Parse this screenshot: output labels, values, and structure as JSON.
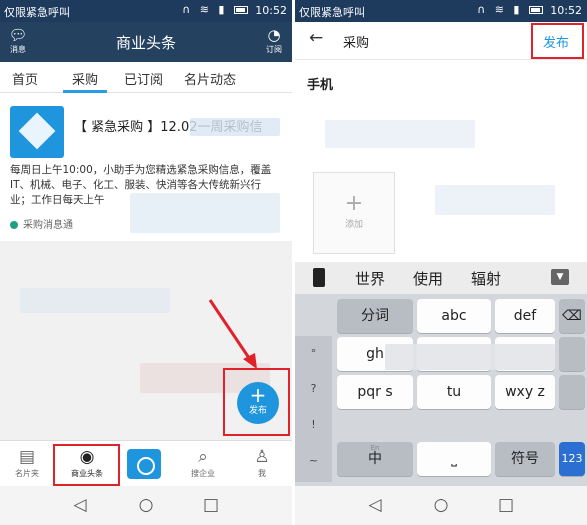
{
  "colors": {
    "status_bar": "#1e3a5c",
    "header": "#24425f",
    "accent": "#1f95dd",
    "highlight": "#e0222a"
  },
  "status_bar": {
    "carrier": "仅限紧急呼叫",
    "icons": "☺ ◎ ▣",
    "right_icons": "∩ ≋ ▮",
    "time": "10:52"
  },
  "left": {
    "header": {
      "title": "商业头条",
      "left_label": "消息",
      "right_label": "订阅"
    },
    "tabs": [
      "首页",
      "采购",
      "已订阅",
      "名片动态"
    ],
    "card": {
      "title": "【 紧急采购 】12.02一周采购信",
      "desc": "每周日上午10:00，小助手为您精选紧急采购信息，覆盖IT、机械、电子、化工、服装、快消等各大传统新兴行业；工作日每天上午",
      "source": "采购消息通"
    },
    "fab": {
      "icon": "+",
      "label": "发布"
    },
    "bottom_nav": [
      {
        "label": "名片夹",
        "icon": "card-icon"
      },
      {
        "label": "商业头条",
        "icon": "record-icon"
      },
      {
        "label": "",
        "icon": "camera-icon"
      },
      {
        "label": "搜企业",
        "icon": "search-icon"
      },
      {
        "label": "我",
        "icon": "person-icon"
      }
    ]
  },
  "right": {
    "header": {
      "back": "←",
      "title": "采购",
      "publish": "发布"
    },
    "body_text": "手机",
    "add_photo": {
      "icon": "+",
      "label": "添加"
    },
    "candidates": [
      "世界",
      "使用",
      "辐射"
    ],
    "collapse_icon": "▼",
    "side_keys": [
      "°",
      "?",
      "!",
      "~"
    ],
    "keys": {
      "row1": [
        {
          "sub": "",
          "main": "分词"
        },
        {
          "sub": "",
          "main": "abc"
        },
        {
          "sub": "",
          "main": "def"
        },
        {
          "sub": "",
          "main": "⌫"
        }
      ],
      "row2": [
        {
          "sub": "",
          "main": "gh"
        },
        {
          "sub": "",
          "main": ""
        },
        {
          "sub": "",
          "main": ""
        },
        {
          "sub": "",
          "main": ""
        }
      ],
      "row3": [
        {
          "sub": "",
          "main": "pqr s"
        },
        {
          "sub": "",
          "main": "tu"
        },
        {
          "sub": "",
          "main": "wxy z"
        },
        {
          "sub": "",
          "main": ""
        }
      ],
      "row4": [
        {
          "sub": "En",
          "main": "中"
        },
        {
          "sub": "",
          "main": "⎵"
        },
        {
          "sub": "",
          "main": "符号"
        },
        {
          "sub": "",
          "main": "123"
        }
      ]
    }
  },
  "system_nav": {
    "back": "◁",
    "home": "○",
    "recent": "□"
  }
}
